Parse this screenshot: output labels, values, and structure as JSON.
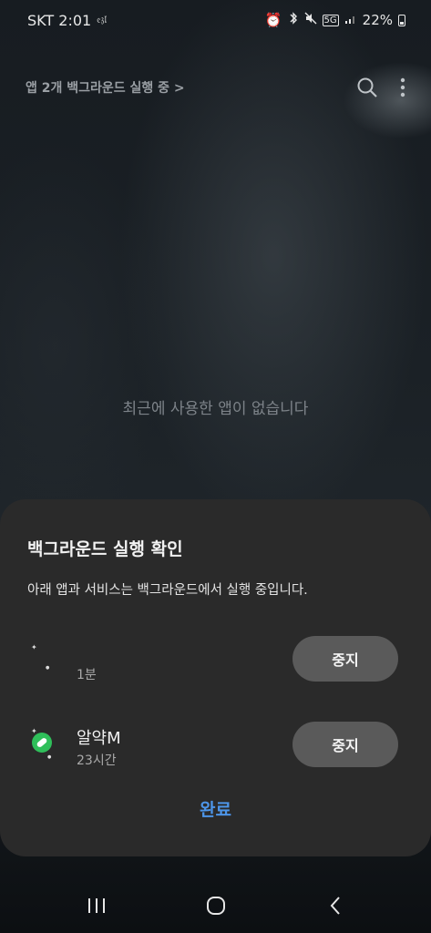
{
  "status_bar": {
    "carrier_time": "SKT 2:01",
    "small_indicator": "𝔢𝔷𝔩",
    "network_badge": "5G",
    "battery_percent": "22%"
  },
  "header": {
    "background_label": "앱 2개 백그라운드 실행 중 >"
  },
  "empty_state": {
    "message": "최근에 사용한 앱이 없습니다"
  },
  "sheet": {
    "title": "백그라운드 실행 확인",
    "subtitle": "아래 앱과 서비스는 백그라운드에서 실행 중입니다.",
    "apps": [
      {
        "name": "",
        "time": "1분",
        "stop_label": "중지"
      },
      {
        "name": "알약M",
        "time": "23시간",
        "stop_label": "중지"
      }
    ],
    "done_label": "완료"
  },
  "colors": {
    "sheet_bg": "#2a2a2a",
    "stop_button": "#5a5a5a",
    "accent_done": "#4d95e8",
    "alyac_icon": "#2fbf5a"
  },
  "icons": {
    "search": "search-icon",
    "more": "more-vert-icon",
    "nav_recents": "recents-icon",
    "nav_home": "home-icon",
    "nav_back": "back-icon"
  }
}
